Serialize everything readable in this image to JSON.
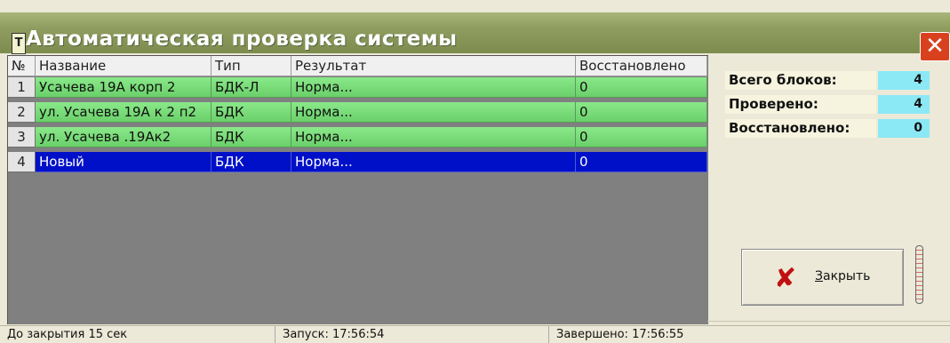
{
  "window": {
    "title": "Автоматическая проверка системы",
    "icon_glyph": "T",
    "close_glyph": "✕"
  },
  "table": {
    "columns": [
      "№",
      "Название",
      "Тип",
      "Результат",
      "Восстановлено"
    ],
    "rows": [
      {
        "num": "1",
        "name": "Усачева 19А корп 2",
        "type": "БДК-Л",
        "result": "Норма...",
        "restored": "0"
      },
      {
        "num": "2",
        "name": "ул. Усачева 19А к 2 п2",
        "type": "БДК",
        "result": "Норма...",
        "restored": "0"
      },
      {
        "num": "3",
        "name": "ул. Усачева .19Ак2",
        "type": "БДК",
        "result": "Норма...",
        "restored": "0"
      },
      {
        "num": "4",
        "name": "Новый",
        "type": "БДК",
        "result": "Норма...",
        "restored": "0"
      }
    ]
  },
  "stats": {
    "total_label": "Всего блоков:",
    "total_value": "4",
    "checked_label": "Проверено:",
    "checked_value": "4",
    "restored_label": "Восстановлено:",
    "restored_value": "0"
  },
  "close_button": {
    "icon": "✘",
    "underline_char": "З",
    "label_rest": "акрыть"
  },
  "status": {
    "countdown": "До закрытия 15 сек",
    "start": "Запуск: 17:56:54",
    "finish": "Завершено: 17:56:55"
  },
  "colors": {
    "row_ok": "#78dc78",
    "row_selected": "#0010c8",
    "stat_value_bg": "#8be9f5",
    "title_bar": "#8e9c5f"
  }
}
